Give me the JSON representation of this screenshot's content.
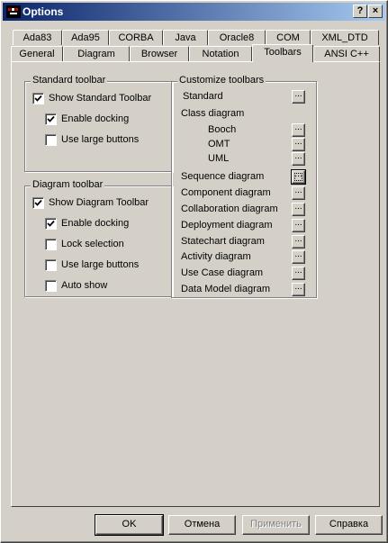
{
  "window": {
    "title": "Options",
    "help_button": "?",
    "close_button": "×"
  },
  "tabs_row1": [
    "Ada83",
    "Ada95",
    "CORBA",
    "Java",
    "Oracle8",
    "COM",
    "XML_DTD"
  ],
  "tabs_row2": [
    "General",
    "Diagram",
    "Browser",
    "Notation",
    "Toolbars",
    "ANSI C++"
  ],
  "active_tab": "Toolbars",
  "standard_toolbar": {
    "title": "Standard toolbar",
    "show": {
      "label": "Show Standard Toolbar",
      "checked": true
    },
    "docking": {
      "label": "Enable docking",
      "checked": true
    },
    "large": {
      "label": "Use large buttons",
      "checked": false
    }
  },
  "diagram_toolbar": {
    "title": "Diagram toolbar",
    "show": {
      "label": "Show Diagram Toolbar",
      "checked": true
    },
    "docking": {
      "label": "Enable docking",
      "checked": true
    },
    "lock": {
      "label": "Lock selection",
      "checked": false
    },
    "large": {
      "label": "Use large buttons",
      "checked": false
    },
    "autoshow": {
      "label": "Auto show",
      "checked": false
    }
  },
  "customize": {
    "title": "Customize toolbars",
    "standard": "Standard",
    "class_diagram": "Class diagram",
    "booch": "Booch",
    "omt": "OMT",
    "uml": "UML",
    "sequence": "Sequence diagram",
    "component": "Component diagram",
    "collaboration": "Collaboration diagram",
    "deployment": "Deployment diagram",
    "statechart": "Statechart diagram",
    "activity": "Activity diagram",
    "usecase": "Use Case diagram",
    "datamodel": "Data Model diagram",
    "ellipsis": "..."
  },
  "buttons": {
    "ok": "OK",
    "cancel": "Отмена",
    "apply": "Применить",
    "help": "Справка"
  }
}
